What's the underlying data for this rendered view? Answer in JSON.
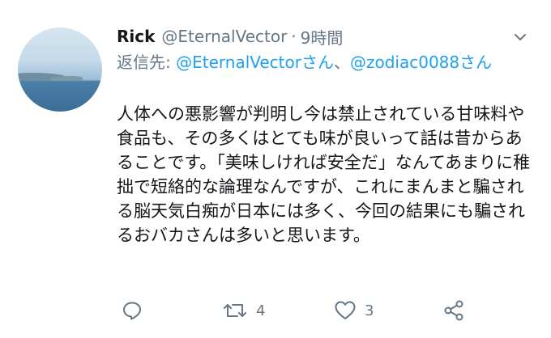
{
  "tweet": {
    "name": "Rick",
    "handle": "@EternalVector",
    "separator": "·",
    "time": "9時間",
    "reply_prefix": "返信先: ",
    "reply_to_1": "@EternalVectorさん",
    "reply_sep": "、",
    "reply_to_2": "@zodiac0088さん",
    "text": "人体への悪影響が判明し今は禁止されている甘味料や食品も、その多くはとても味が良いって話は昔からあることです。「美味しければ安全だ」なんてあまりに稚拙で短絡的な論理なんですが、これにまんまと騙される脳天気白痴が日本には多く、今回の結果にも騙されるおバカさんは多いと思います。",
    "retweet_count": "4",
    "like_count": "3"
  },
  "icons": {
    "caret": "chevron-down-icon",
    "reply": "reply-icon",
    "retweet": "retweet-icon",
    "like": "heart-icon",
    "share": "share-icon"
  },
  "colors": {
    "link": "#1da1f2",
    "muted": "#657786",
    "text": "#14171a"
  }
}
